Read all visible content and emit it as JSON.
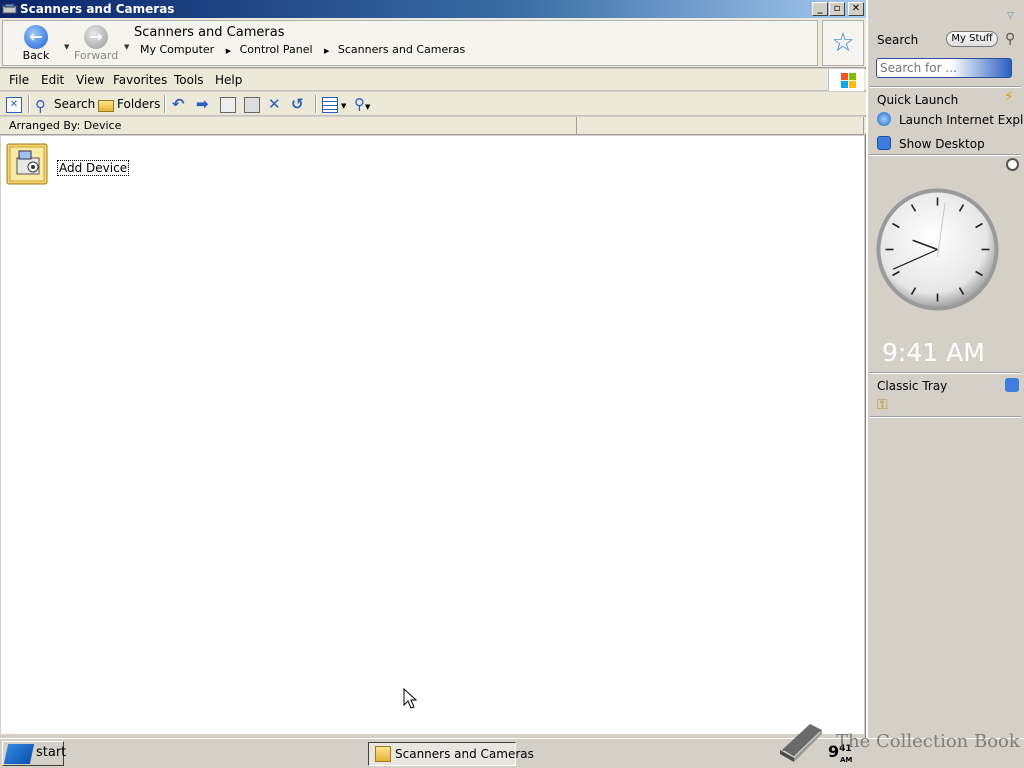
{
  "window": {
    "title": "Scanners and Cameras",
    "controls": {
      "minimize": "_",
      "maximize": "▫",
      "close": "✕"
    }
  },
  "nav": {
    "back_label": "Back",
    "forward_label": "Forward",
    "location_title": "Scanners and Cameras",
    "breadcrumbs": [
      "My Computer",
      "Control Panel",
      "Scanners and Cameras"
    ]
  },
  "menu": {
    "items": [
      "File",
      "Edit",
      "View",
      "Favorites",
      "Tools",
      "Help"
    ]
  },
  "toolbar": {
    "search_label": "Search",
    "folders_label": "Folders"
  },
  "list": {
    "header": "Arranged By: Device",
    "items": [
      {
        "label": "Add Device"
      }
    ]
  },
  "sidebar": {
    "search": {
      "title": "Search",
      "my_stuff": "My Stuff",
      "placeholder": "Search for ..."
    },
    "quick_launch": {
      "title": "Quick Launch",
      "items": [
        "Launch Internet Explorer",
        "Show Desktop"
      ]
    },
    "clock": {
      "digital": "9:41 AM",
      "hours": 9,
      "minutes": 41
    },
    "classic_tray": {
      "title": "Classic Tray"
    }
  },
  "taskbar": {
    "start_label": "start",
    "task_button": "Scanners and Cameras",
    "clock_hour": "9",
    "clock_minutes": "41",
    "clock_ampm": "AM",
    "watermark": "The Collection Book"
  },
  "colors": {
    "title_active": "#0a246a",
    "face": "#d4d0c8",
    "accent_blue": "#2a5fc0"
  },
  "icons": {
    "back": "arrow-left-circle",
    "forward": "arrow-right-circle",
    "favorites": "star",
    "add_device": "scanner-camera-folder",
    "quick_launch": "lightning-bolt",
    "clock": "clock",
    "tray": "keys"
  }
}
